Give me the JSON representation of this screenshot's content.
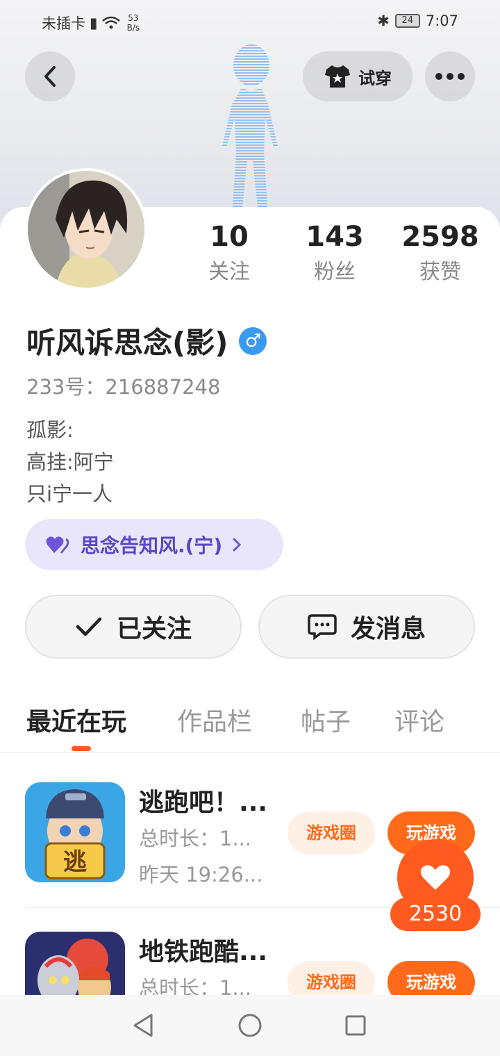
{
  "status_bar": {
    "carrier": "未插卡",
    "speed_value": "53",
    "speed_unit": "B/s",
    "battery": "24",
    "time": "7:07"
  },
  "top_actions": {
    "try_on_label": "试穿"
  },
  "profile": {
    "stats": [
      {
        "value": "10",
        "label": "关注"
      },
      {
        "value": "143",
        "label": "粉丝"
      },
      {
        "value": "2598",
        "label": "获赞"
      }
    ],
    "name": "听风诉思念(影)",
    "gender_symbol": "♂",
    "id_label": "233号：",
    "id_value": "216887248",
    "bio_lines": [
      "孤影:",
      "高挂:阿宁",
      "只i宁一人"
    ],
    "tag_label": "思念告知风.(宁)"
  },
  "actions": {
    "follow_label": "已关注",
    "message_label": "发消息"
  },
  "tabs": [
    "最近在玩",
    "作品栏",
    "帖子",
    "评论"
  ],
  "games": [
    {
      "title": "逃跑吧！...",
      "duration": "总时长：1...",
      "last_played": "昨天 19:26...",
      "icon_text": "逃",
      "circle_label": "游戏圈",
      "play_label": "玩游戏"
    },
    {
      "title": "地铁跑酷...",
      "duration": "总时长：1...",
      "circle_label": "游戏圈",
      "play_label": "玩游戏"
    }
  ],
  "like": {
    "count": "2530"
  },
  "colors": {
    "accent": "#ff5a1f",
    "tag_bg": "#e9e6fb",
    "tag_text": "#5b46c7",
    "gender_blue": "#3a9af0"
  }
}
